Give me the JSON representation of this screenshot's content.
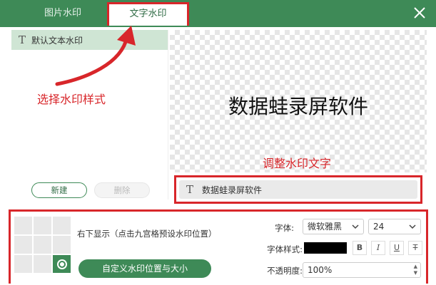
{
  "tabs": {
    "image": "图片水印",
    "text": "文字水印"
  },
  "watermark_list": {
    "items": [
      {
        "label": "默认文本水印"
      }
    ]
  },
  "annotations": {
    "select_style": "选择水印样式",
    "adjust_text": "调整水印文字"
  },
  "buttons": {
    "new": "新建",
    "delete": "删除",
    "custom_position": "自定义水印位置与大小"
  },
  "preview": {
    "text": "数据蛙录屏软件"
  },
  "text_input": {
    "value": "数据蛙录屏软件"
  },
  "position": {
    "description": "右下显示（点击九宫格预设水印位置）"
  },
  "font": {
    "label": "字体:",
    "family": "微软雅黑",
    "size": "24",
    "style_label": "字体样式:",
    "color": "#000000"
  },
  "style_buttons": {
    "bold": "B",
    "italic": "I",
    "underline": "U",
    "strike": "T"
  },
  "opacity": {
    "label": "不透明度:",
    "value": "100%"
  },
  "colors": {
    "brand": "#3e8a57",
    "highlight": "#d8262a",
    "selected_item": "#cfe5d4"
  }
}
